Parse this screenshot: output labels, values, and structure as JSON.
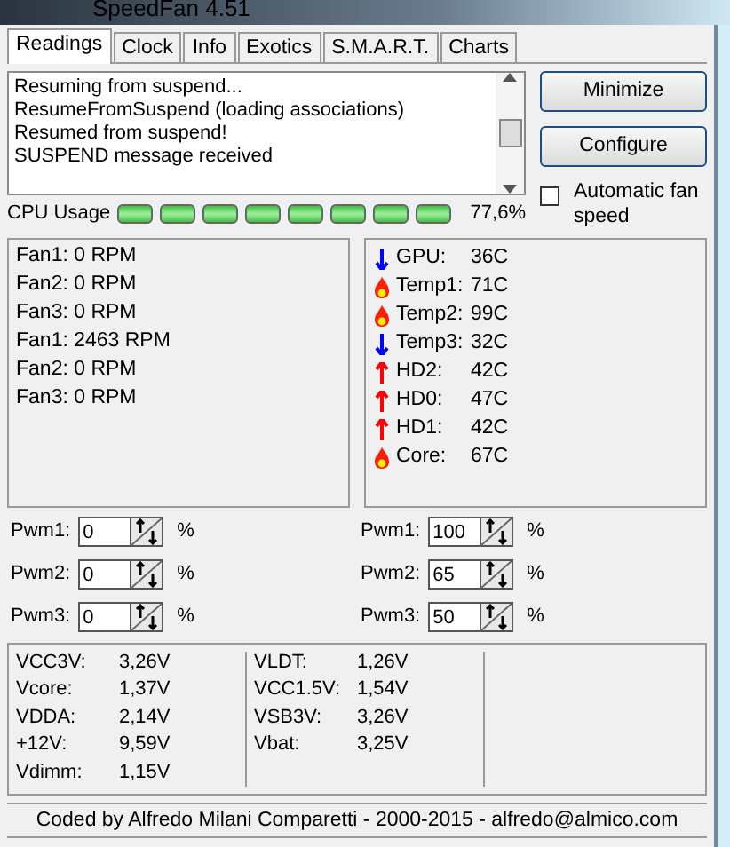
{
  "window": {
    "title": "SpeedFan 4.51"
  },
  "tabs": [
    {
      "label": "Readings",
      "selected": true
    },
    {
      "label": "Clock",
      "selected": false
    },
    {
      "label": "Info",
      "selected": false
    },
    {
      "label": "Exotics",
      "selected": false
    },
    {
      "label": "S.M.A.R.T.",
      "selected": false
    },
    {
      "label": "Charts",
      "selected": false
    }
  ],
  "log": [
    "Resuming from suspend...",
    "ResumeFromSuspend (loading associations)",
    "Resumed from suspend!",
    "SUSPEND message received"
  ],
  "buttons": [
    "Minimize",
    "Configure"
  ],
  "auto_fan_speed": {
    "label": "Automatic fan speed",
    "checked": false
  },
  "cpu_usage": {
    "label": "CPU Usage",
    "level": 0.776,
    "reading": "77,6%"
  },
  "fans": [
    "Fan1: 0 RPM",
    "Fan2: 0 RPM",
    "Fan3: 0 RPM",
    "Fan1: 2463 RPM",
    "Fan2: 0 RPM",
    "Fan3: 0 RPM"
  ],
  "temperatures": [
    {
      "label": "GPU:",
      "value": "36C",
      "kind": "down"
    },
    {
      "label": "Temp1:",
      "value": "71C",
      "kind": "fire"
    },
    {
      "label": "Temp2:",
      "value": "99C",
      "kind": "fire"
    },
    {
      "label": "Temp3:",
      "value": "32C",
      "kind": "down"
    },
    {
      "label": "HD2:",
      "value": "42C",
      "kind": "up"
    },
    {
      "label": "HD0:",
      "value": "47C",
      "kind": "up"
    },
    {
      "label": "HD1:",
      "value": "42C",
      "kind": "up"
    },
    {
      "label": "Core:",
      "value": "67C",
      "kind": "fire"
    }
  ],
  "pwm_left": [
    {
      "label": "Pwm1:",
      "value": "0",
      "unit": "%"
    },
    {
      "label": "Pwm2:",
      "value": "0",
      "unit": "%"
    },
    {
      "label": "Pwm3:",
      "value": "0",
      "unit": "%"
    }
  ],
  "pwm_right": [
    {
      "label": "Pwm1:",
      "value": "100",
      "unit": "%"
    },
    {
      "label": "Pwm2:",
      "value": "65",
      "unit": "%"
    },
    {
      "label": "Pwm3:",
      "value": "50",
      "unit": "%"
    }
  ],
  "voltages_column_1": [
    {
      "label": "VCC3V:",
      "value": "3,26V"
    },
    {
      "label": "Vcore:",
      "value": "1,37V"
    },
    {
      "label": "VDDA:",
      "value": "2,14V"
    },
    {
      "label": "+12V:",
      "value": "9,59V"
    },
    {
      "label": "Vdimm:",
      "value": "1,15V"
    }
  ],
  "voltages_column_2": [
    {
      "label": "VLDT:",
      "value": "1,26V"
    },
    {
      "label": "VCC1.5V:",
      "value": "1,54V"
    },
    {
      "label": "VSB3V:",
      "value": "3,26V"
    },
    {
      "label": "Vbat:",
      "value": "3,25V"
    }
  ],
  "status_bar": "Coded by Alfredo Milani Comparetti - 2000-2015 - alfredo@almico.com"
}
